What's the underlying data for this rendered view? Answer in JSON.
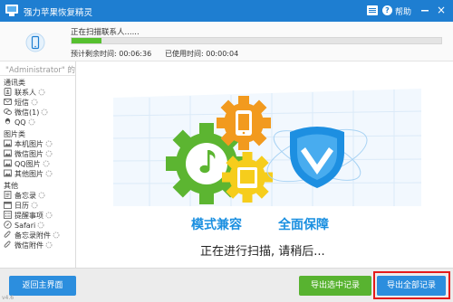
{
  "window": {
    "title": "强力苹果恢复精灵",
    "help_label": "帮助",
    "close_glyph": "×"
  },
  "scan": {
    "status_text": "正在扫描联系人......",
    "progress": 0.08,
    "remaining_label": "预计剩余时间: 00:06:36",
    "used_label": "已使用时间: 00:00:04"
  },
  "sidebar": {
    "device_name": "\"Administrator\" 的",
    "groups": [
      {
        "label": "通讯类",
        "items": [
          {
            "label": "联系人",
            "icon": "contacts-icon"
          },
          {
            "label": "短信",
            "icon": "sms-icon"
          },
          {
            "label": "微信(1)",
            "icon": "wechat-icon"
          },
          {
            "label": "QQ",
            "icon": "qq-icon"
          }
        ]
      },
      {
        "label": "图片类",
        "items": [
          {
            "label": "本机图片",
            "icon": "photo-icon"
          },
          {
            "label": "微信图片",
            "icon": "photo-icon"
          },
          {
            "label": "QQ图片",
            "icon": "photo-icon"
          },
          {
            "label": "其他图片",
            "icon": "photo-icon"
          }
        ]
      },
      {
        "label": "其他",
        "items": [
          {
            "label": "备忘录",
            "icon": "memo-icon"
          },
          {
            "label": "日历",
            "icon": "calendar-icon"
          },
          {
            "label": "提醒事项",
            "icon": "reminder-icon"
          },
          {
            "label": "Safari",
            "icon": "safari-icon"
          },
          {
            "label": "备忘录附件",
            "icon": "attachment-icon"
          },
          {
            "label": "微信附件",
            "icon": "attachment-icon"
          }
        ]
      }
    ]
  },
  "main": {
    "slogan_left": "模式兼容",
    "slogan_right": "全面保障",
    "scanning_message": "正在进行扫描, 请稍后..."
  },
  "footer": {
    "home_button": "返回主界面",
    "export_selected_button": "导出选中记录",
    "export_all_button": "导出全部记录",
    "version": "v4.6"
  },
  "colors": {
    "titlebar": "#1e7ed1",
    "progress": "#56c02f",
    "accent_blue": "#2c8ede",
    "accent_green": "#58b330",
    "highlight": "#e41b1b"
  }
}
